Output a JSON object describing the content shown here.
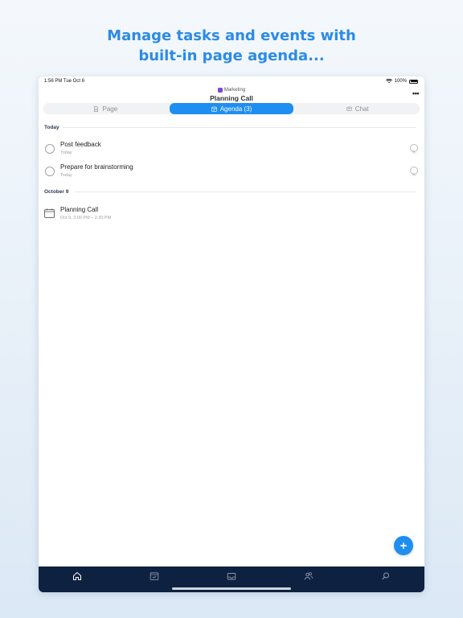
{
  "headline": {
    "line1": "Manage tasks and events with",
    "line2": "built-in page agenda..."
  },
  "status_bar": {
    "time": "1:56 PM  Tue Oct 6",
    "battery": "100%"
  },
  "header": {
    "workspace": "Marketing",
    "title": "Planning Call",
    "more_icon": "more-horizontal-icon"
  },
  "segments": [
    {
      "label": "Page",
      "icon": "document-icon",
      "active": false
    },
    {
      "label": "Agenda (3)",
      "icon": "agenda-icon",
      "active": true
    },
    {
      "label": "Chat",
      "icon": "chat-icon",
      "active": false
    }
  ],
  "agenda": {
    "sections": [
      {
        "header": "Today",
        "items": [
          {
            "title": "Post feedback",
            "subtitle": "Today",
            "type": "task"
          },
          {
            "title": "Prepare for brainstorming",
            "subtitle": "Today",
            "type": "task"
          }
        ]
      },
      {
        "header": "October 9",
        "items": [
          {
            "title": "Planning Call",
            "subtitle": "Oct 9, 2:00 PM – 2:30 PM",
            "type": "event"
          }
        ]
      }
    ]
  },
  "fab": {
    "label": "+"
  },
  "tab_bar": {
    "items": [
      "home-icon",
      "agenda-icon",
      "inbox-icon",
      "people-icon",
      "search-icon"
    ],
    "active": "home-icon"
  },
  "colors": {
    "accent": "#1f8ef1",
    "headline": "#2a8be8",
    "tab_bar": "#0f2140"
  }
}
